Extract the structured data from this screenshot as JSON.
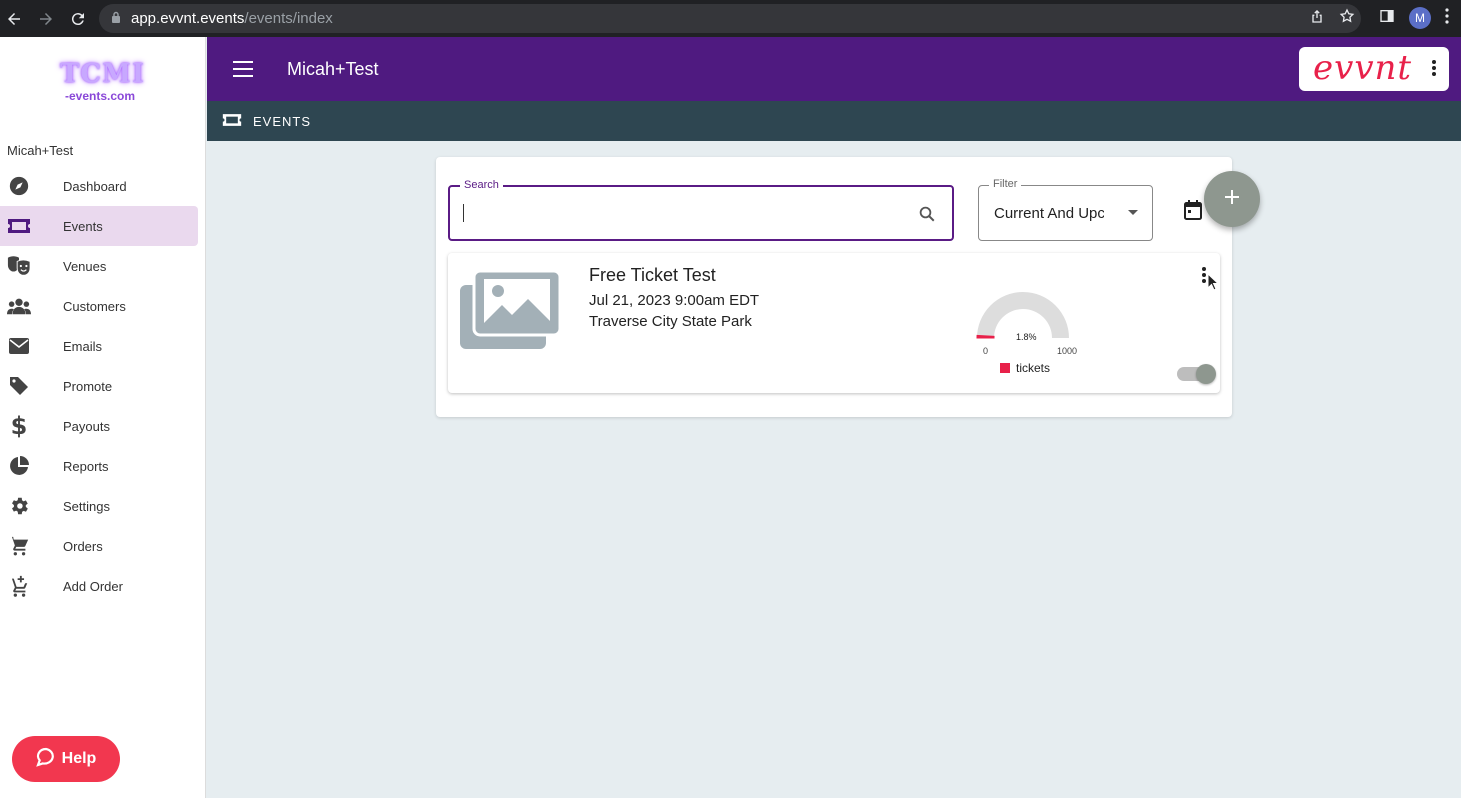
{
  "browser": {
    "url_host": "app.evvnt.events",
    "url_path": "/events/index",
    "profile_initial": "M"
  },
  "sidebar": {
    "logo_top": "TCMI",
    "logo_bottom": "-events.com",
    "org_name": "Micah+Test",
    "items": [
      {
        "label": "Dashboard",
        "icon": "compass-icon"
      },
      {
        "label": "Events",
        "icon": "ticket-icon",
        "active": true
      },
      {
        "label": "Venues",
        "icon": "theater-masks-icon"
      },
      {
        "label": "Customers",
        "icon": "people-icon"
      },
      {
        "label": "Emails",
        "icon": "envelope-icon"
      },
      {
        "label": "Promote",
        "icon": "tag-icon"
      },
      {
        "label": "Payouts",
        "icon": "dollar-icon"
      },
      {
        "label": "Reports",
        "icon": "pie-chart-icon"
      },
      {
        "label": "Settings",
        "icon": "gear-icon"
      },
      {
        "label": "Orders",
        "icon": "cart-icon"
      },
      {
        "label": "Add Order",
        "icon": "cart-plus-icon"
      }
    ],
    "help_label": "Help"
  },
  "header": {
    "title": "Micah+Test",
    "brand": "evvnt"
  },
  "subheader": {
    "title": "EVENTS"
  },
  "search": {
    "label": "Search",
    "value": ""
  },
  "filter": {
    "label": "Filter",
    "value": "Current And Upcoming"
  },
  "event": {
    "title": "Free Ticket Test",
    "date": "Jul 21, 2023 9:00am EDT",
    "venue": "Traverse City State Park",
    "gauge": {
      "percent_label": "1.8%",
      "percent": 1.8,
      "min_label": "0",
      "max_label": "1000",
      "legend": "tickets"
    },
    "published": true
  },
  "colors": {
    "primary": "#4f1a80",
    "subheader": "#2e4651",
    "accent": "#e8214a",
    "fab": "#8e978f"
  }
}
